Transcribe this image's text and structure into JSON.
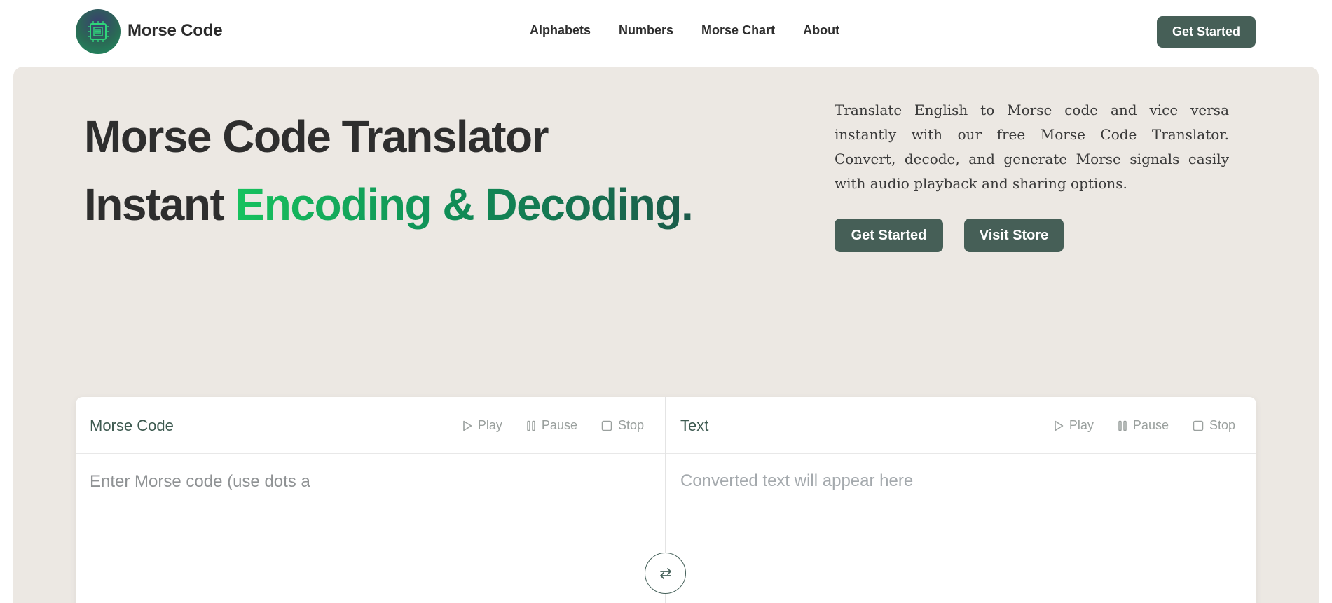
{
  "nav": {
    "brand": "Morse Code",
    "links": [
      "Alphabets",
      "Numbers",
      "Morse Chart",
      "About"
    ],
    "cta": "Get Started"
  },
  "hero": {
    "line1": "Morse Code Translator",
    "line2_plain": "Instant ",
    "line2_highlight": "Encoding & Decoding.",
    "description": "Translate English to Morse code and vice versa instantly with our free Morse Code Translator. Convert, decode, and generate Morse signals easily with audio playback and sharing options.",
    "primary_button": "Get Started",
    "secondary_button": "Visit Store"
  },
  "translator": {
    "left": {
      "title": "Morse Code",
      "placeholder": "Enter Morse code (use dots a",
      "controls": [
        "Play",
        "Pause",
        "Stop"
      ]
    },
    "right": {
      "title": "Text",
      "placeholder": "Converted text will appear here",
      "controls": [
        "Play",
        "Pause",
        "Stop"
      ]
    }
  },
  "colors": {
    "accent": "#465f57",
    "hero_bg": "#ece8e3",
    "gradient_start": "#17c25e",
    "gradient_end": "#1b5a4a"
  },
  "icons": [
    "logo-icon",
    "play-icon",
    "pause-icon",
    "stop-icon",
    "swap-icon"
  ]
}
